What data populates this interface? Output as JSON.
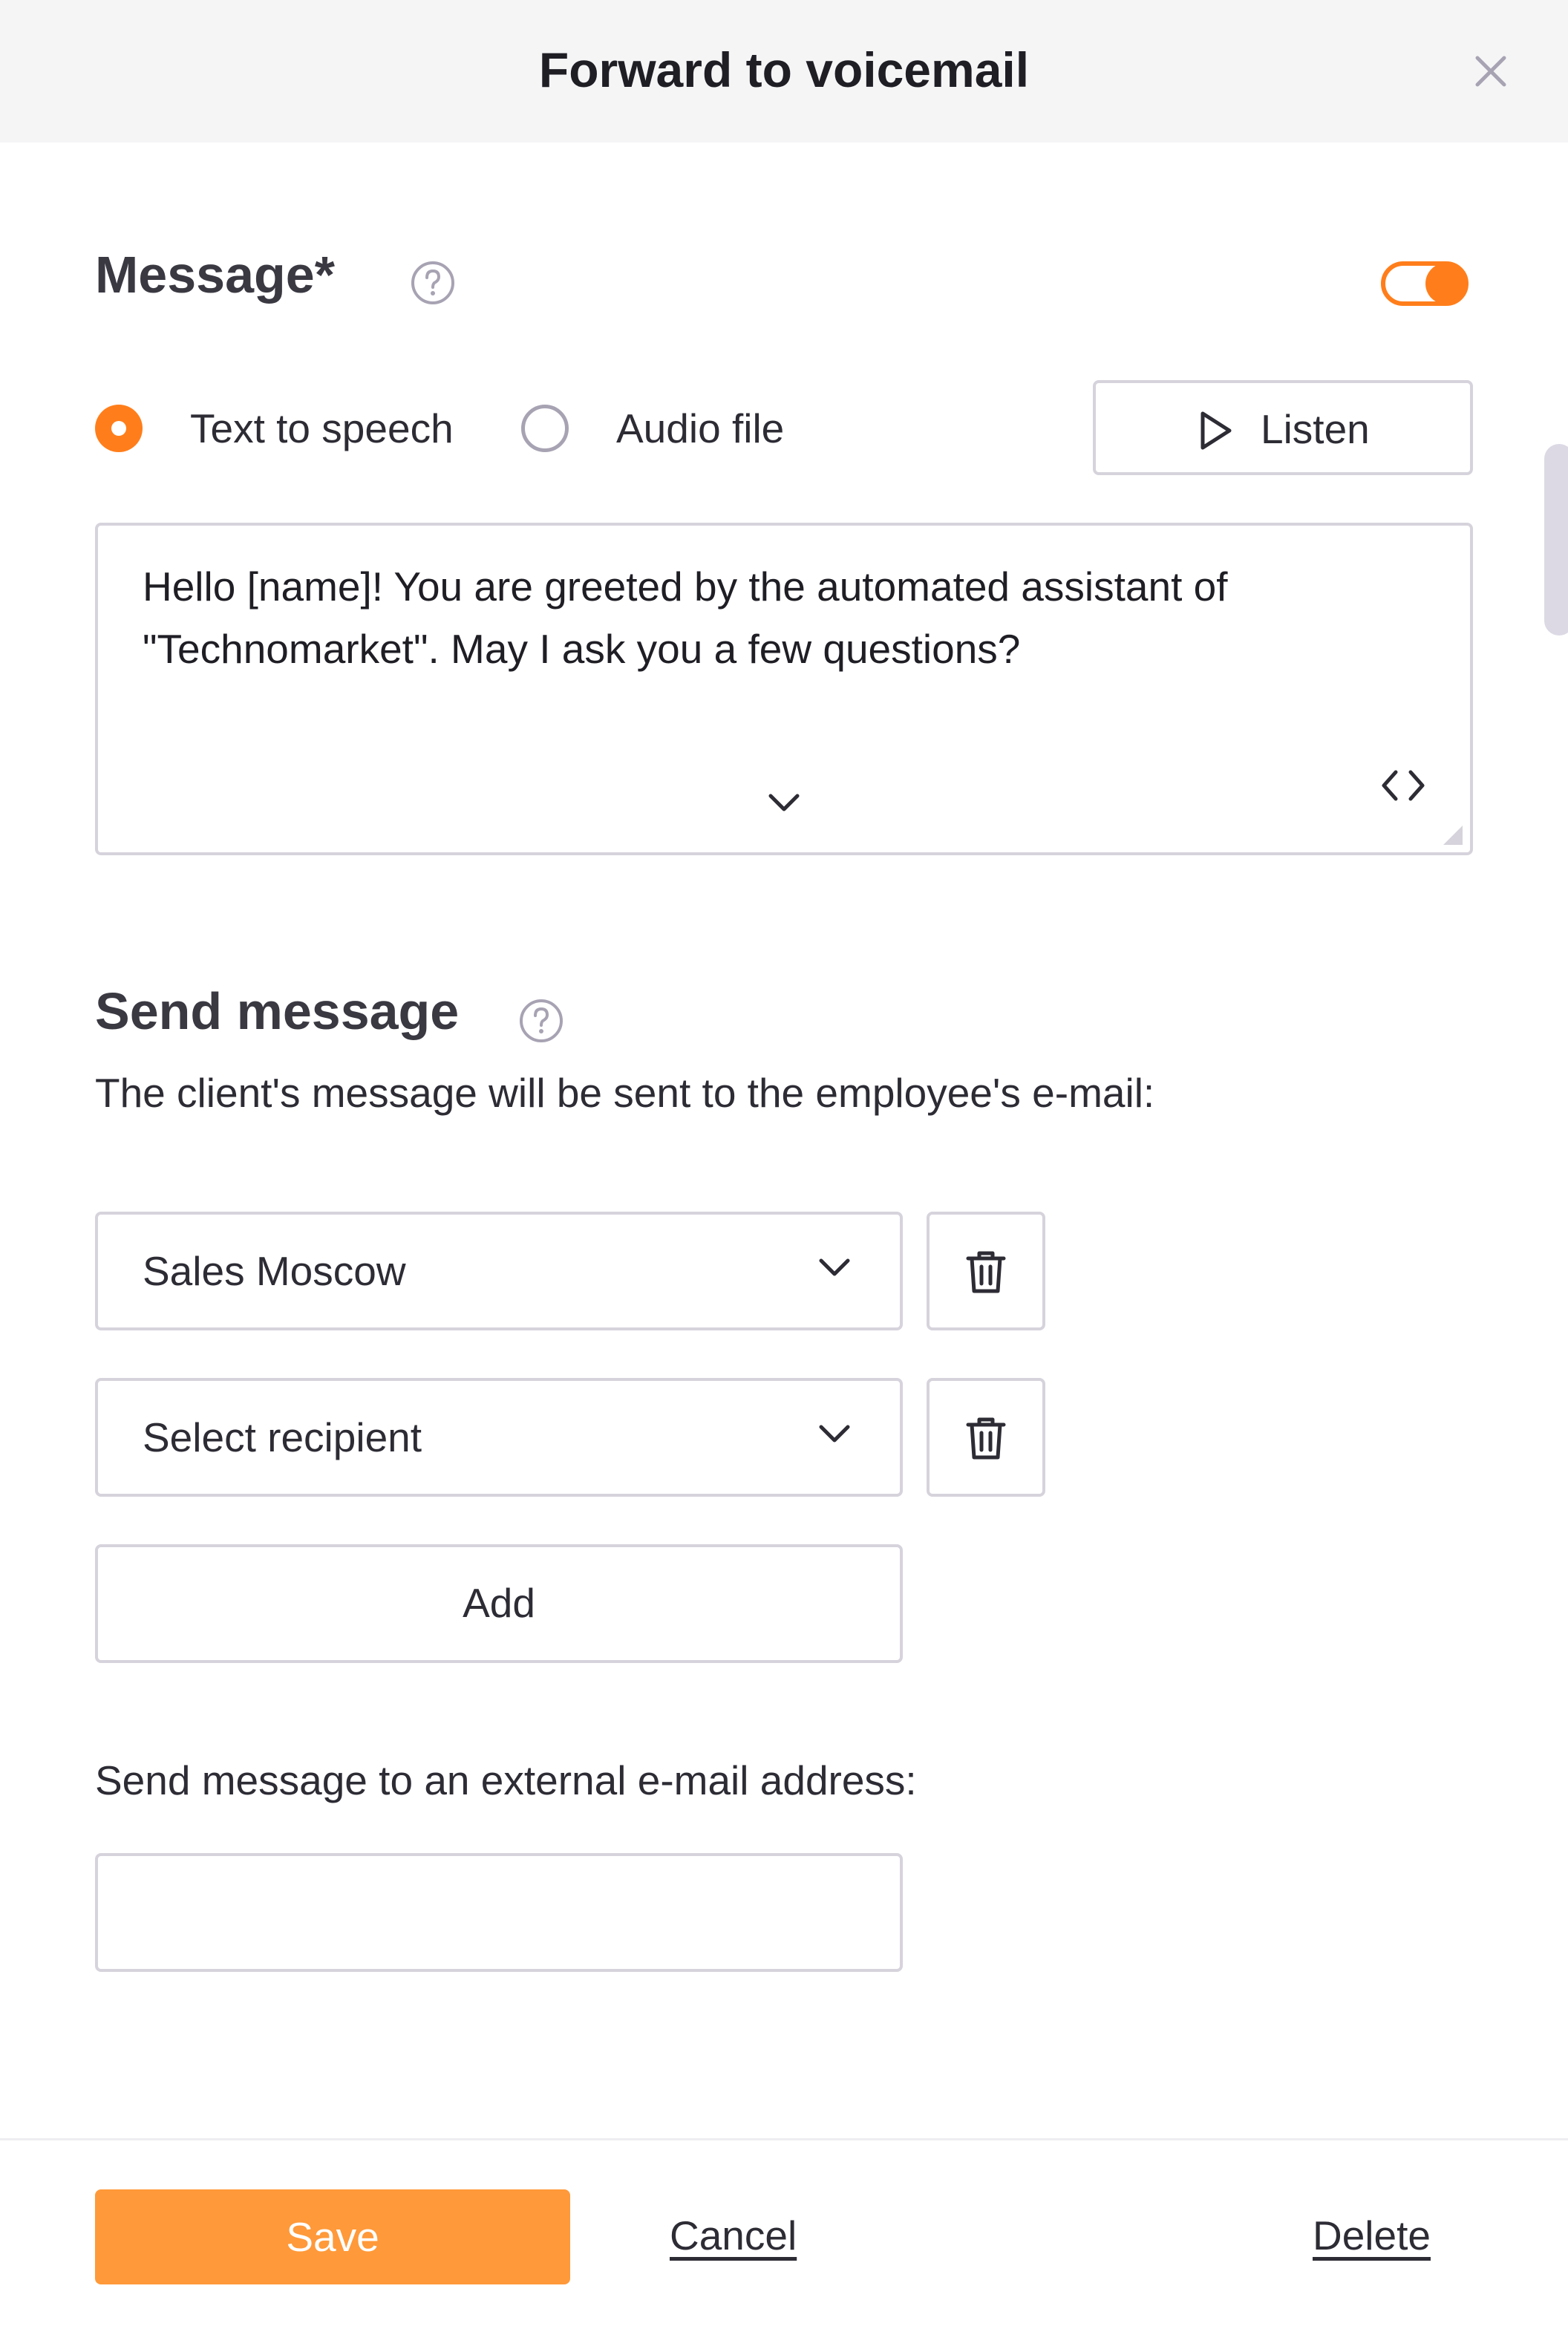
{
  "dialog": {
    "title": "Forward to voicemail"
  },
  "message_section": {
    "title": "Message*",
    "toggle_on": true,
    "options": [
      {
        "label": "Text to speech",
        "selected": true
      },
      {
        "label": "Audio file",
        "selected": false
      }
    ],
    "listen_label": "Listen",
    "text": "Hello [name]! You are greeted by the automated assistant of \"Technomarket\". May I ask you a few questions?"
  },
  "send_section": {
    "title": "Send message",
    "description": "The client's message will be sent to the employee's e-mail:",
    "recipients": [
      {
        "value": "Sales Moscow"
      },
      {
        "value": "Select recipient"
      }
    ],
    "add_label": "Add",
    "external_label": "Send message to an external e-mail address:",
    "external_value": ""
  },
  "footer": {
    "save_label": "Save",
    "cancel_label": "Cancel",
    "delete_label": "Delete"
  },
  "colors": {
    "accent": "#ff7e1b",
    "save_button": "#ff9939",
    "border": "#d6d3dc",
    "header_bg": "#f5f5f6"
  }
}
